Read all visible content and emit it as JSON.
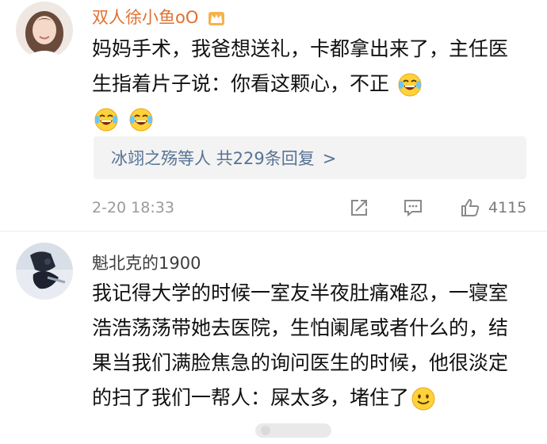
{
  "comments": [
    {
      "username": "双人徐小鱼oO",
      "badge_icon": "vip-crown-icon",
      "text": "妈妈手术，我爸想送礼，卡都拿出来了，主任医生指着片子说：你看这颗心，不正",
      "text_emojis": [
        "laughing-crying-icon",
        "laughing-crying-icon",
        "laughing-crying-icon"
      ],
      "reply_summary": "冰翊之殇等人 共229条回复",
      "reply_arrow": ">",
      "timestamp": "2-20 18:33",
      "like_count": "4115"
    },
    {
      "username": "魁北克的1900",
      "text": "我记得大学的时候一室友半夜肚痛难忍，一寝室浩浩荡荡带她去医院，生怕阑尾或者什么的，结果当我们满脸焦急的询问医生的时候，他很淡定的扫了我们一帮人：屎太多，堵住了",
      "text_emojis": [
        "smile-icon"
      ]
    }
  ],
  "colors": {
    "username_vip": "#e07030",
    "username_normal": "#3d3d3d",
    "reply_link": "#577395",
    "reply_bg": "#f3f3f3",
    "meta_text": "#9a9a9a"
  }
}
